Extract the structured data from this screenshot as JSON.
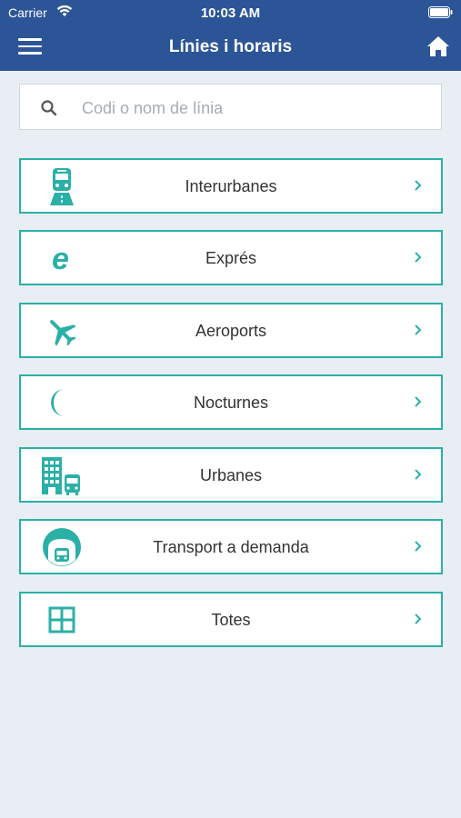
{
  "status_bar": {
    "carrier": "Carrier",
    "time": "10:03 AM"
  },
  "nav": {
    "title": "Línies i horaris"
  },
  "search": {
    "placeholder": "Codi o nom de línia",
    "value": ""
  },
  "categories": [
    {
      "label": "Interurbanes",
      "icon": "bus-road-icon"
    },
    {
      "label": "Exprés",
      "icon": "express-e-icon"
    },
    {
      "label": "Aeroports",
      "icon": "airplane-icon"
    },
    {
      "label": "Nocturnes",
      "icon": "moon-icon"
    },
    {
      "label": "Urbanes",
      "icon": "city-bus-icon"
    },
    {
      "label": "Transport a demanda",
      "icon": "demand-transport-icon"
    },
    {
      "label": "Totes",
      "icon": "grid-icon"
    }
  ],
  "colors": {
    "header": "#2c5597",
    "accent": "#2bb0a7",
    "background": "#e8eef3"
  }
}
